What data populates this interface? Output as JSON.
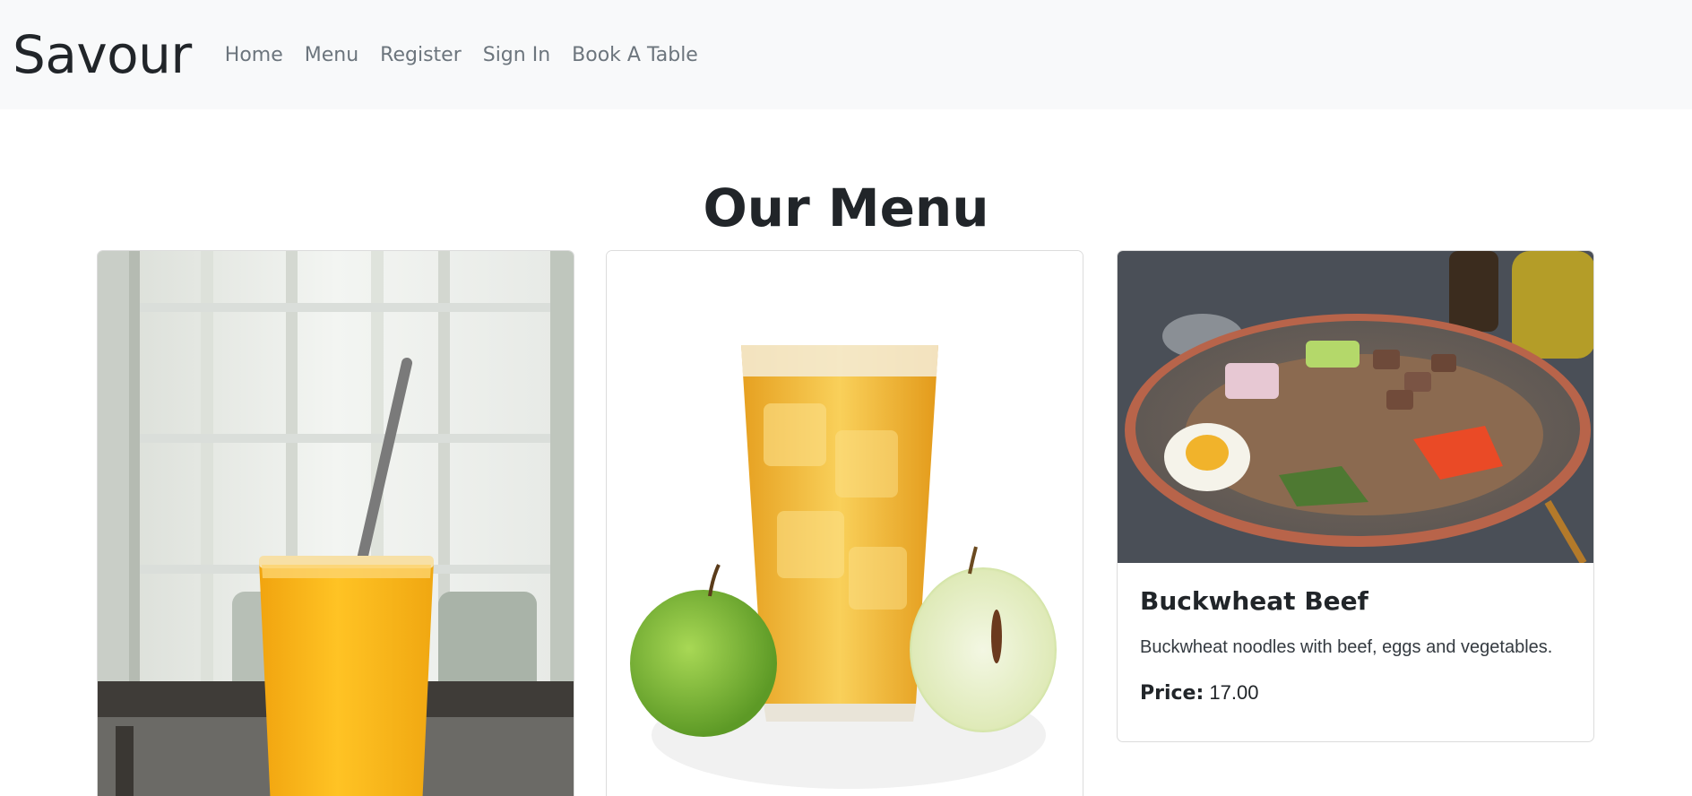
{
  "nav": {
    "brand": "Savour",
    "links": [
      "Home",
      "Menu",
      "Register",
      "Sign In",
      "Book A Table"
    ]
  },
  "page": {
    "title": "Our Menu"
  },
  "cards": [
    {
      "image": "orange-juice-photo"
    },
    {
      "image": "apple-juice-photo"
    },
    {
      "image": "buckwheat-beef-bowl-photo",
      "title": "Buckwheat Beef",
      "description": "Buckwheat noodles with beef, eggs and vegetables.",
      "price_label": "Price:",
      "price": "17.00"
    }
  ]
}
